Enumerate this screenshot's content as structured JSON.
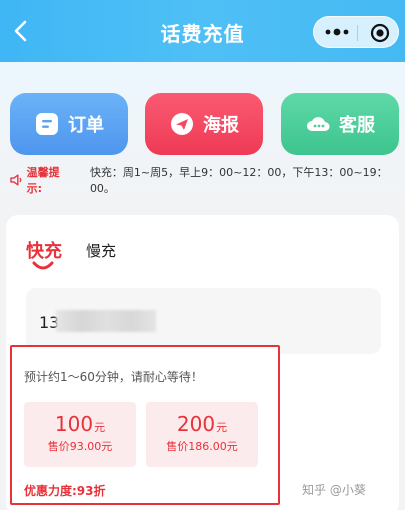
{
  "header": {
    "title": "话费充值",
    "back_icon": "chevron-left-icon",
    "more_icon": "more-dots-icon",
    "close_icon": "target-circle-icon"
  },
  "actions": [
    {
      "label": "订单",
      "icon": "order-doc-icon",
      "color": "#5aa3f2"
    },
    {
      "label": "海报",
      "icon": "send-plane-icon",
      "color": "#f24a63"
    },
    {
      "label": "客服",
      "icon": "cloud-service-icon",
      "color": "#4dcf9b"
    }
  ],
  "tip": {
    "label": "温馨提示:",
    "text": "快充：周1~周5，早上9：00~12：00，下午13：00~19：00。"
  },
  "tabs": {
    "fast": "快充",
    "slow": "慢充"
  },
  "phone": {
    "prefix": "13"
  },
  "recharge": {
    "wait_text": "预计约1～60分钟，请耐心等待！",
    "options": [
      {
        "amount": "100",
        "unit": "元",
        "price": "售价93.00元"
      },
      {
        "amount": "200",
        "unit": "元",
        "price": "售价186.00元"
      }
    ],
    "discount": "优惠力度:93折"
  },
  "watermark": "知乎 @小葵",
  "colors": {
    "accent_red": "#e8323a",
    "header_blue": "#45b9f3"
  }
}
